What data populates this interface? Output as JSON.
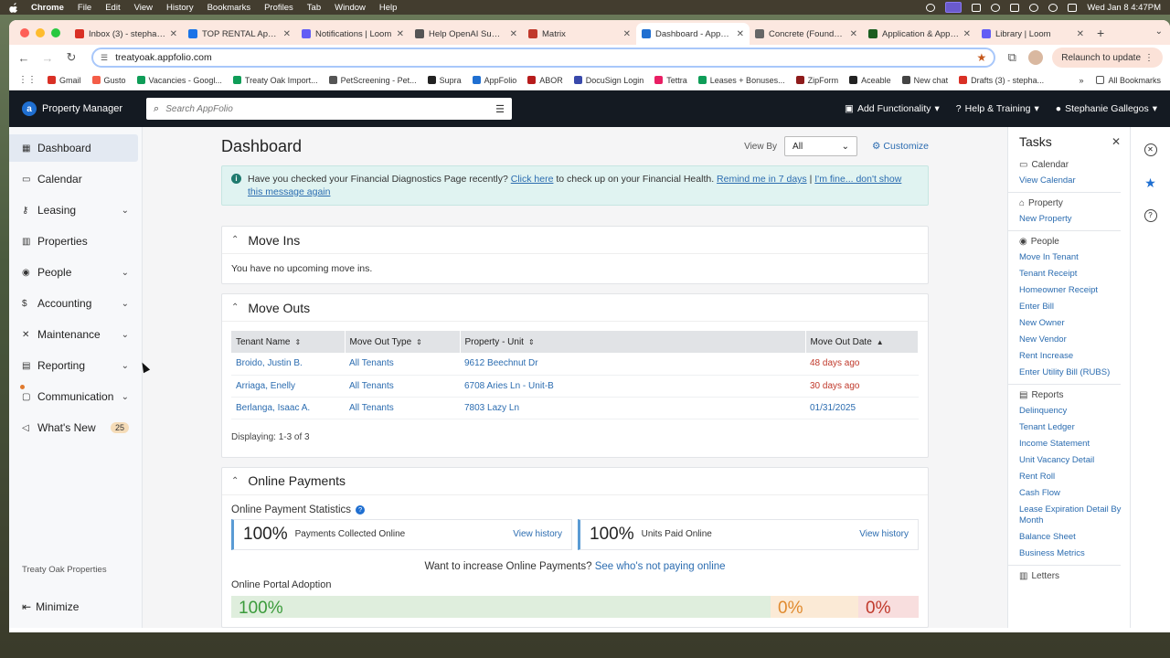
{
  "mac": {
    "app": "Chrome",
    "menus": [
      "File",
      "Edit",
      "View",
      "History",
      "Bookmarks",
      "Profiles",
      "Tab",
      "Window",
      "Help"
    ],
    "clock": "Wed Jan 8  4:47PM"
  },
  "browser": {
    "tabs": [
      {
        "title": "Inbox (3) - stephanie",
        "color": "#d93025"
      },
      {
        "title": "TOP RENTAL Applications",
        "color": "#1a73e8"
      },
      {
        "title": "Notifications | Loom",
        "color": "#625df5"
      },
      {
        "title": "Help OpenAI Summary",
        "color": "#555555"
      },
      {
        "title": "Matrix",
        "color": "#c0392b"
      },
      {
        "title": "Dashboard - AppFolio",
        "color": "#1f6fd1"
      },
      {
        "title": "Concrete (Foundation",
        "color": "#666666"
      },
      {
        "title": "Application & Approval",
        "color": "#1b5e20"
      },
      {
        "title": "Library | Loom",
        "color": "#625df5"
      }
    ],
    "active_tab_index": 5,
    "url": "treatyoak.appfolio.com",
    "relaunch": "Relaunch to update",
    "bookmarks": [
      {
        "label": "Gmail",
        "color": "#d93025"
      },
      {
        "label": "Gusto",
        "color": "#f45d48"
      },
      {
        "label": "Vacancies - Googl...",
        "color": "#0f9d58"
      },
      {
        "label": "Treaty Oak Import...",
        "color": "#0f9d58"
      },
      {
        "label": "PetScreening - Pet...",
        "color": "#555555"
      },
      {
        "label": "Supra",
        "color": "#222222"
      },
      {
        "label": "AppFolio",
        "color": "#1f6fd1"
      },
      {
        "label": "ABOR",
        "color": "#b71c1c"
      },
      {
        "label": "DocuSign Login",
        "color": "#3949ab"
      },
      {
        "label": "Tettra",
        "color": "#e91e63"
      },
      {
        "label": "Leases + Bonuses...",
        "color": "#0f9d58"
      },
      {
        "label": "ZipForm",
        "color": "#8e1b1b"
      },
      {
        "label": "Aceable",
        "color": "#222222"
      },
      {
        "label": "New chat",
        "color": "#444444"
      },
      {
        "label": "Drafts (3) - stepha...",
        "color": "#d93025"
      }
    ],
    "all_bookmarks": "All Bookmarks"
  },
  "topnav": {
    "brand": "Property Manager",
    "search_placeholder": "Search AppFolio",
    "add_functionality": "Add Functionality",
    "help": "Help & Training",
    "user": "Stephanie Gallegos"
  },
  "sidebar": {
    "items": [
      {
        "label": "Dashboard",
        "icon": "grid-icon"
      },
      {
        "label": "Calendar",
        "icon": "calendar-icon"
      },
      {
        "label": "Leasing",
        "icon": "key-icon"
      },
      {
        "label": "Properties",
        "icon": "building-icon"
      },
      {
        "label": "People",
        "icon": "person-icon"
      },
      {
        "label": "Accounting",
        "icon": "dollar-icon"
      },
      {
        "label": "Maintenance",
        "icon": "tools-icon"
      },
      {
        "label": "Reporting",
        "icon": "chart-icon"
      },
      {
        "label": "Communication",
        "icon": "inbox-icon"
      },
      {
        "label": "What's New",
        "icon": "megaphone-icon",
        "badge": "25"
      }
    ],
    "company": "Treaty Oak Properties",
    "minimize": "Minimize"
  },
  "dashboard": {
    "title": "Dashboard",
    "view_by_label": "View By",
    "view_by_value": "All",
    "customize": "Customize",
    "alert": {
      "text1": "Have you checked your Financial Diagnostics Page recently?",
      "link1": "Click here",
      "text2": "to check up on your Financial Health.",
      "link2": "Remind me in 7 days",
      "sep": "|",
      "link3": "I'm fine... don't show this message again"
    },
    "move_ins": {
      "title": "Move Ins",
      "empty": "You have no upcoming move ins."
    },
    "move_outs": {
      "title": "Move Outs",
      "columns": [
        "Tenant Name",
        "Move Out Type",
        "Property - Unit",
        "Move Out Date"
      ],
      "rows": [
        {
          "tenant": "Broido, Justin B.",
          "type": "All Tenants",
          "unit": "9612 Beechnut Dr",
          "date": "48 days ago"
        },
        {
          "tenant": "Arriaga, Enelly",
          "type": "All Tenants",
          "unit": "6708 Aries Ln - Unit-B",
          "date": "30 days ago"
        },
        {
          "tenant": "Berlanga, Isaac A.",
          "type": "All Tenants",
          "unit": "7803 Lazy Ln",
          "date": "01/31/2025"
        }
      ],
      "displaying": "Displaying: 1-3 of 3"
    },
    "online_payments": {
      "title": "Online Payments",
      "stats_title": "Online Payment Statistics",
      "stat1_value": "100%",
      "stat1_label": "Payments Collected Online",
      "stat2_value": "100%",
      "stat2_label": "Units Paid Online",
      "view_history": "View history",
      "increase_text": "Want to increase Online Payments?",
      "increase_link": "See who's not paying online",
      "adoption_title": "Online Portal Adoption",
      "adoption": [
        "100%",
        "0%",
        "0%"
      ]
    }
  },
  "tasks": {
    "title": "Tasks",
    "groups": [
      {
        "name": "Calendar",
        "links": [
          "View Calendar"
        ]
      },
      {
        "name": "Property",
        "links": [
          "New Property"
        ]
      },
      {
        "name": "People",
        "links": [
          "Move In Tenant",
          "Tenant Receipt",
          "Homeowner Receipt",
          "Enter Bill",
          "New Owner",
          "New Vendor",
          "Rent Increase",
          "Enter Utility Bill (RUBS)"
        ]
      },
      {
        "name": "Reports",
        "links": [
          "Delinquency",
          "Tenant Ledger",
          "Income Statement",
          "Unit Vacancy Detail",
          "Rent Roll",
          "Cash Flow",
          "Lease Expiration Detail By Month",
          "Balance Sheet",
          "Business Metrics"
        ]
      },
      {
        "name": "Letters",
        "links": []
      }
    ]
  }
}
